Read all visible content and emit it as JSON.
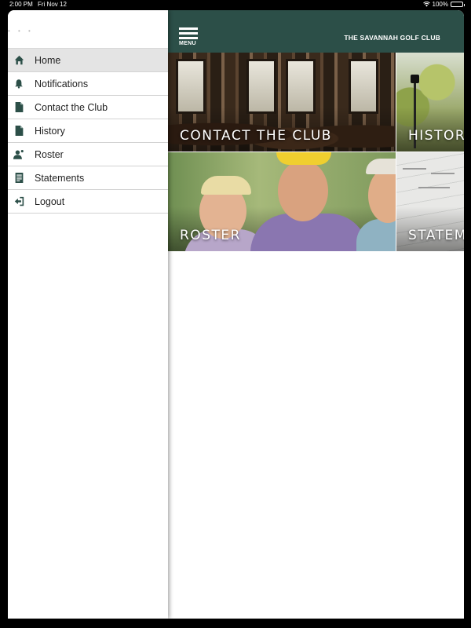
{
  "status_bar": {
    "time": "2:00 PM",
    "date": "Fri Nov 12",
    "battery": "100%",
    "battery_level": 1.0
  },
  "header": {
    "menu_label": "MENU",
    "club_title": "THE SAVANNAH GOLF CLUB",
    "bar_color": "#2c4f48"
  },
  "sidebar": {
    "items": [
      {
        "label": "Home",
        "icon": "home-icon",
        "active": true
      },
      {
        "label": "Notifications",
        "icon": "bell-icon",
        "active": false
      },
      {
        "label": "Contact the Club",
        "icon": "document-icon",
        "active": false
      },
      {
        "label": "History",
        "icon": "document-icon",
        "active": false
      },
      {
        "label": "Roster",
        "icon": "person-icon",
        "active": false
      },
      {
        "label": "Statements",
        "icon": "receipt-icon",
        "active": false
      },
      {
        "label": "Logout",
        "icon": "logout-icon",
        "active": false
      }
    ],
    "icon_color": "#2c4f48"
  },
  "tiles": [
    {
      "label": "CONTACT THE CLUB"
    },
    {
      "label": "HISTORY"
    },
    {
      "label": "ROSTER"
    },
    {
      "label": "STATEMENTS"
    }
  ]
}
